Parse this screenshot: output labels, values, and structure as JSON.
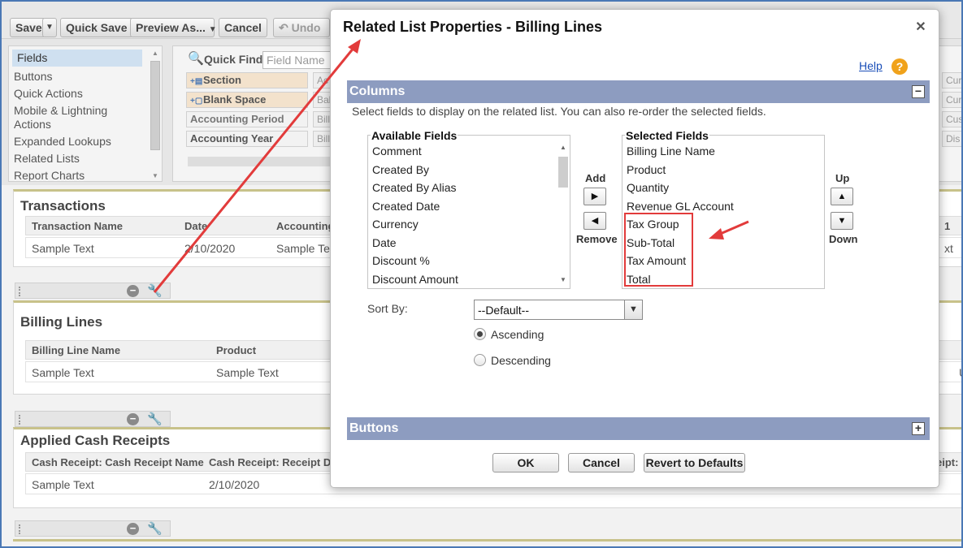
{
  "toolbar": {
    "save": "Save",
    "quick_save": "Quick Save",
    "preview_as": "Preview As...",
    "cancel": "Cancel",
    "undo": "Undo"
  },
  "palette": {
    "nav_items": [
      "Fields",
      "Buttons",
      "Quick Actions",
      "Mobile & Lightning Actions",
      "Expanded Lookups",
      "Related Lists",
      "Report Charts"
    ],
    "quick_find_label": "Quick Find",
    "quick_find_placeholder": "Field Name",
    "chips": [
      "Section",
      "Blank Space",
      "Accounting Period",
      "Accounting Year"
    ],
    "ghost_chips": [
      "Ac",
      "Bal",
      "Bill",
      "Bill"
    ],
    "right_chips": [
      "Cur",
      "Cur",
      "Cus",
      "Dis"
    ]
  },
  "layout": {
    "transactions": {
      "title": "Transactions",
      "columns": [
        "Transaction Name",
        "Date",
        "Accounting"
      ],
      "row": [
        "Sample Text",
        "2/10/2020",
        "Sample Te"
      ],
      "right_col": "1",
      "right_cell": "xt"
    },
    "billing_lines": {
      "title": "Billing Lines",
      "columns": [
        "Billing Line Name",
        "Product"
      ],
      "row": [
        "Sample Text",
        "Sample Text"
      ],
      "right_cell": "U"
    },
    "applied_cash_receipts": {
      "title": "Applied Cash Receipts",
      "columns": [
        "Cash Receipt: Cash Receipt Name",
        "Cash Receipt: Receipt Da"
      ],
      "row": [
        "Sample Text",
        "2/10/2020"
      ],
      "right_col": "eipt:"
    }
  },
  "dialog": {
    "title": "Related List Properties - Billing Lines",
    "help": "Help",
    "columns_header": "Columns",
    "columns_desc": "Select fields to display on the related list. You can also re-order the selected fields.",
    "available_label": "Available Fields",
    "available_fields": [
      "Comment",
      "Created By",
      "Created By Alias",
      "Created Date",
      "Currency",
      "Date",
      "Discount %",
      "Discount Amount"
    ],
    "selected_label": "Selected Fields",
    "selected_fields": [
      "Billing Line Name",
      "Product",
      "Quantity",
      "Revenue GL Account",
      "Tax Group",
      "Sub-Total",
      "Tax Amount",
      "Total"
    ],
    "add_label": "Add",
    "remove_label": "Remove",
    "up_label": "Up",
    "down_label": "Down",
    "sort_by_label": "Sort By:",
    "sort_by_value": "--Default--",
    "ascending": "Ascending",
    "descending": "Descending",
    "buttons_header": "Buttons",
    "ok": "OK",
    "cancel": "Cancel",
    "revert": "Revert to Defaults"
  },
  "colors": {
    "section_bar": "#8d9cc0",
    "highlight": "#e23b3b",
    "help_icon": "#f0a21b",
    "link": "#1b4fb8"
  }
}
